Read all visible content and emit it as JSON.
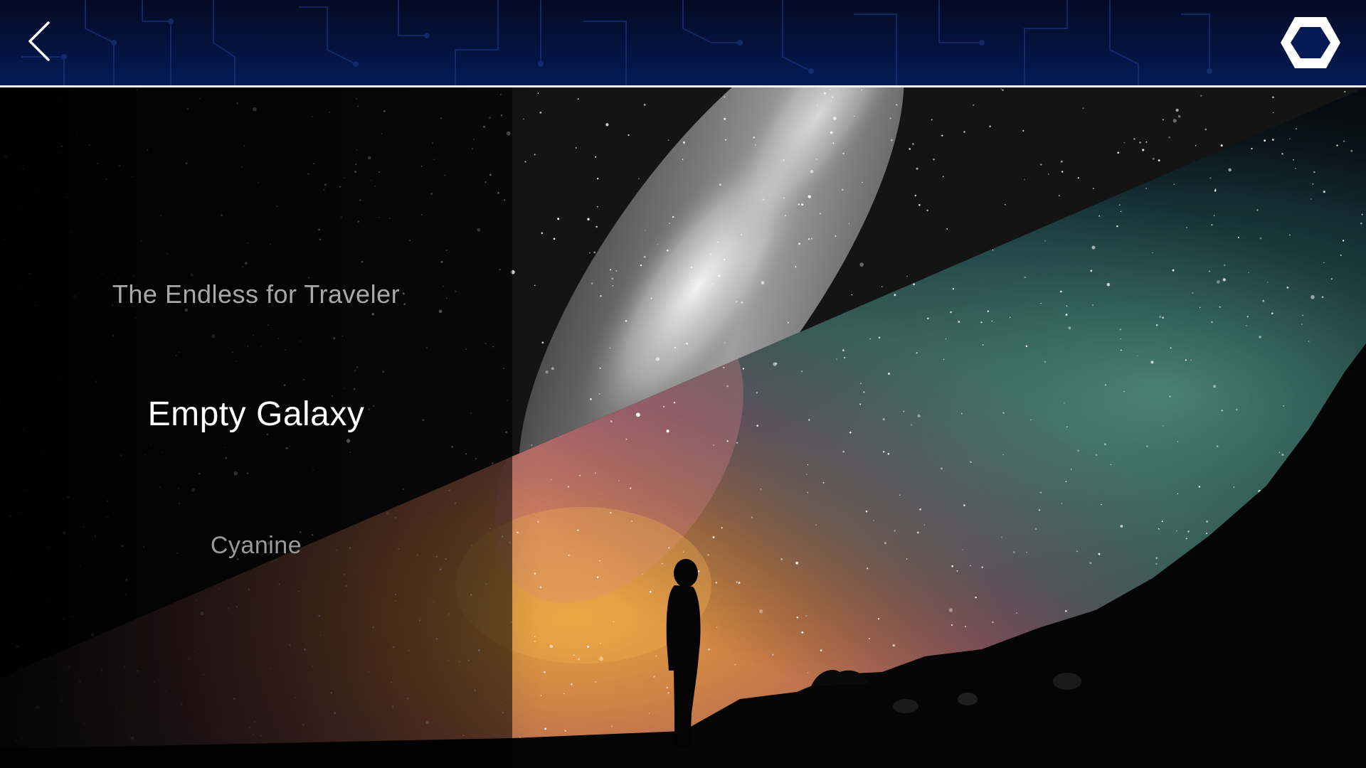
{
  "header": {
    "back_icon": "chevron-left-icon",
    "menu_icon": "hexagon-icon",
    "bar_color": "#051a55",
    "divider_color": "#f2f2f2"
  },
  "menu": {
    "items": [
      {
        "label": "The Endless for Traveler",
        "state": "inactive"
      },
      {
        "label": "Empty Galaxy",
        "state": "selected"
      },
      {
        "label": "Cyanine",
        "state": "inactive"
      }
    ]
  },
  "background": {
    "scene": "night-sky-milky-way-with-silhouette",
    "accent_colors": [
      "#e0a040",
      "#d07080",
      "#70b0a0",
      "#ffffff"
    ]
  }
}
